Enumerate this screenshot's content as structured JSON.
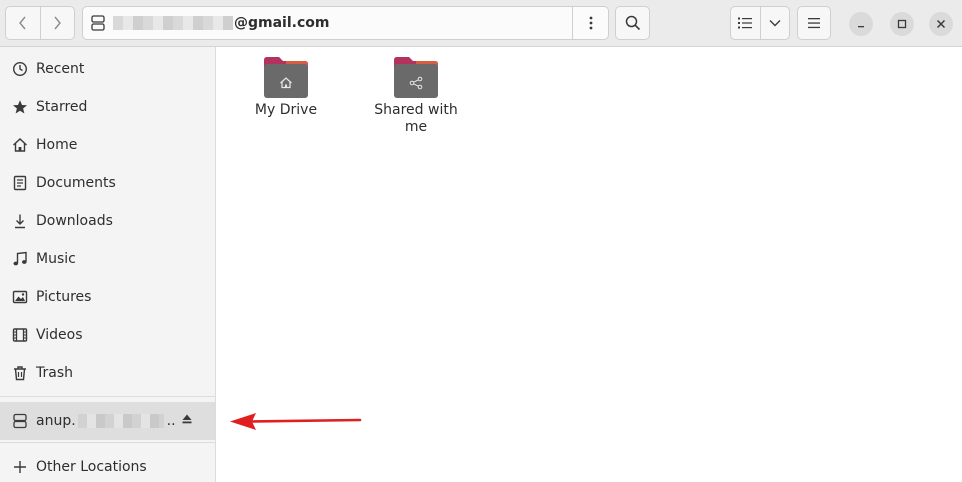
{
  "window": {
    "path_suffix": "@gmail.com"
  },
  "sidebar": {
    "items": [
      {
        "label": "Recent",
        "icon": "clock-icon"
      },
      {
        "label": "Starred",
        "icon": "star-icon"
      },
      {
        "label": "Home",
        "icon": "home-icon"
      },
      {
        "label": "Documents",
        "icon": "document-icon"
      },
      {
        "label": "Downloads",
        "icon": "download-icon"
      },
      {
        "label": "Music",
        "icon": "music-icon"
      },
      {
        "label": "Pictures",
        "icon": "picture-icon"
      },
      {
        "label": "Videos",
        "icon": "video-icon"
      },
      {
        "label": "Trash",
        "icon": "trash-icon"
      }
    ],
    "mount": {
      "label_prefix": "anup.",
      "label_suffix": "..",
      "icon": "drive-icon"
    },
    "other_locations": "Other Locations"
  },
  "content": {
    "folders": [
      {
        "label": "My Drive",
        "icon": "home-icon"
      },
      {
        "label": "Shared with me",
        "icon": "share-icon"
      }
    ]
  },
  "colors": {
    "folder_tab": "#b3325f",
    "folder_tab_accent": "#e0673a",
    "folder_body": "#6a6a6a",
    "annotation_arrow": "#e02020",
    "sidebar_selected": "#dedede"
  }
}
